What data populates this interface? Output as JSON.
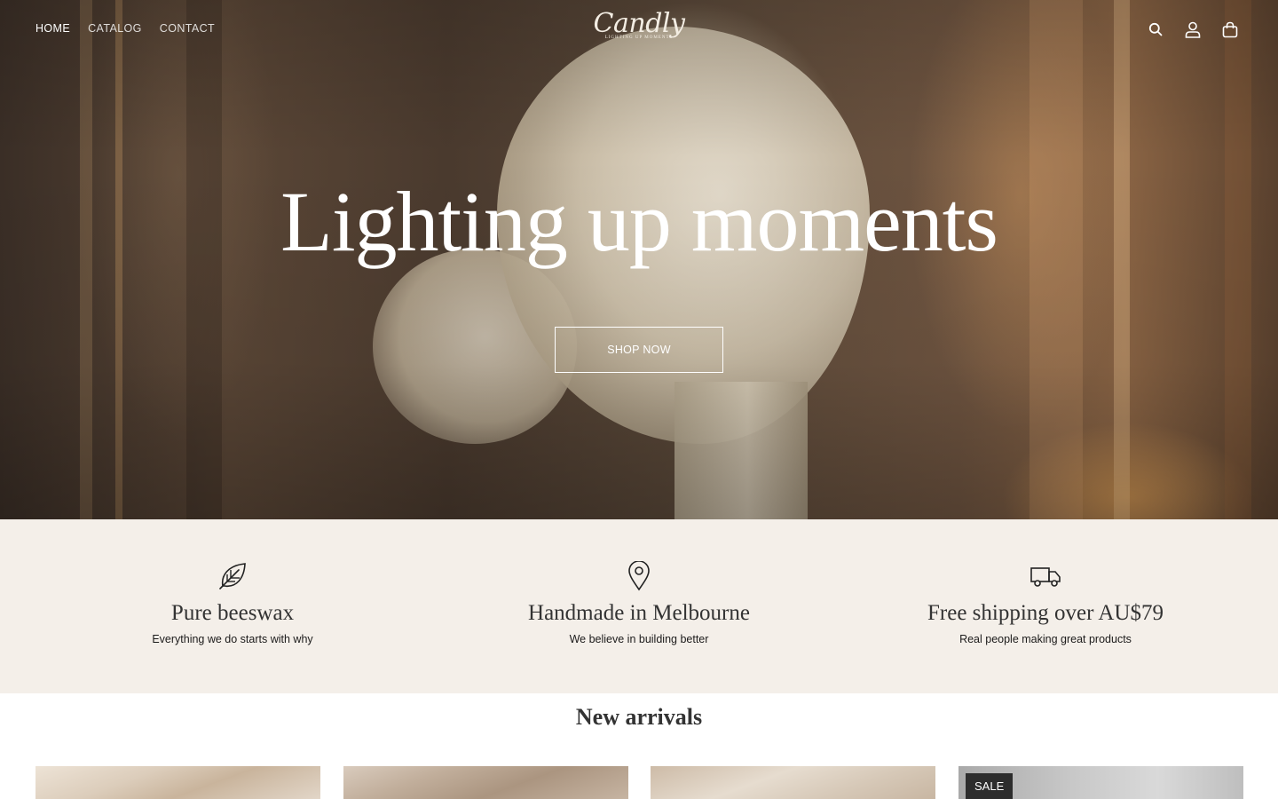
{
  "nav": {
    "items": [
      {
        "label": "HOME",
        "active": true
      },
      {
        "label": "CATALOG",
        "active": false
      },
      {
        "label": "CONTACT",
        "active": false
      }
    ]
  },
  "logo": {
    "wordmark": "Candly",
    "tagline": "LIGHTING UP MOMENTS"
  },
  "header_icons": [
    "search-icon",
    "account-icon",
    "cart-icon"
  ],
  "hero": {
    "title": "Lighting up moments",
    "cta_label": "SHOP NOW"
  },
  "features": [
    {
      "icon": "leaf-icon",
      "title": "Pure beeswax",
      "description": "Everything we do starts with why"
    },
    {
      "icon": "map-pin-icon",
      "title": "Handmade in Melbourne",
      "description": "We believe in building better"
    },
    {
      "icon": "truck-icon",
      "title": "Free shipping over AU$79",
      "description": "Real people making great products"
    }
  ],
  "new_arrivals": {
    "title": "New arrivals",
    "products": [
      {
        "badge": ""
      },
      {
        "badge": ""
      },
      {
        "badge": ""
      },
      {
        "badge": "SALE"
      }
    ]
  },
  "colors": {
    "feature_bg": "#f4efe9",
    "badge_bg": "#2d2d2d",
    "text_dark": "#1c1b1b"
  }
}
